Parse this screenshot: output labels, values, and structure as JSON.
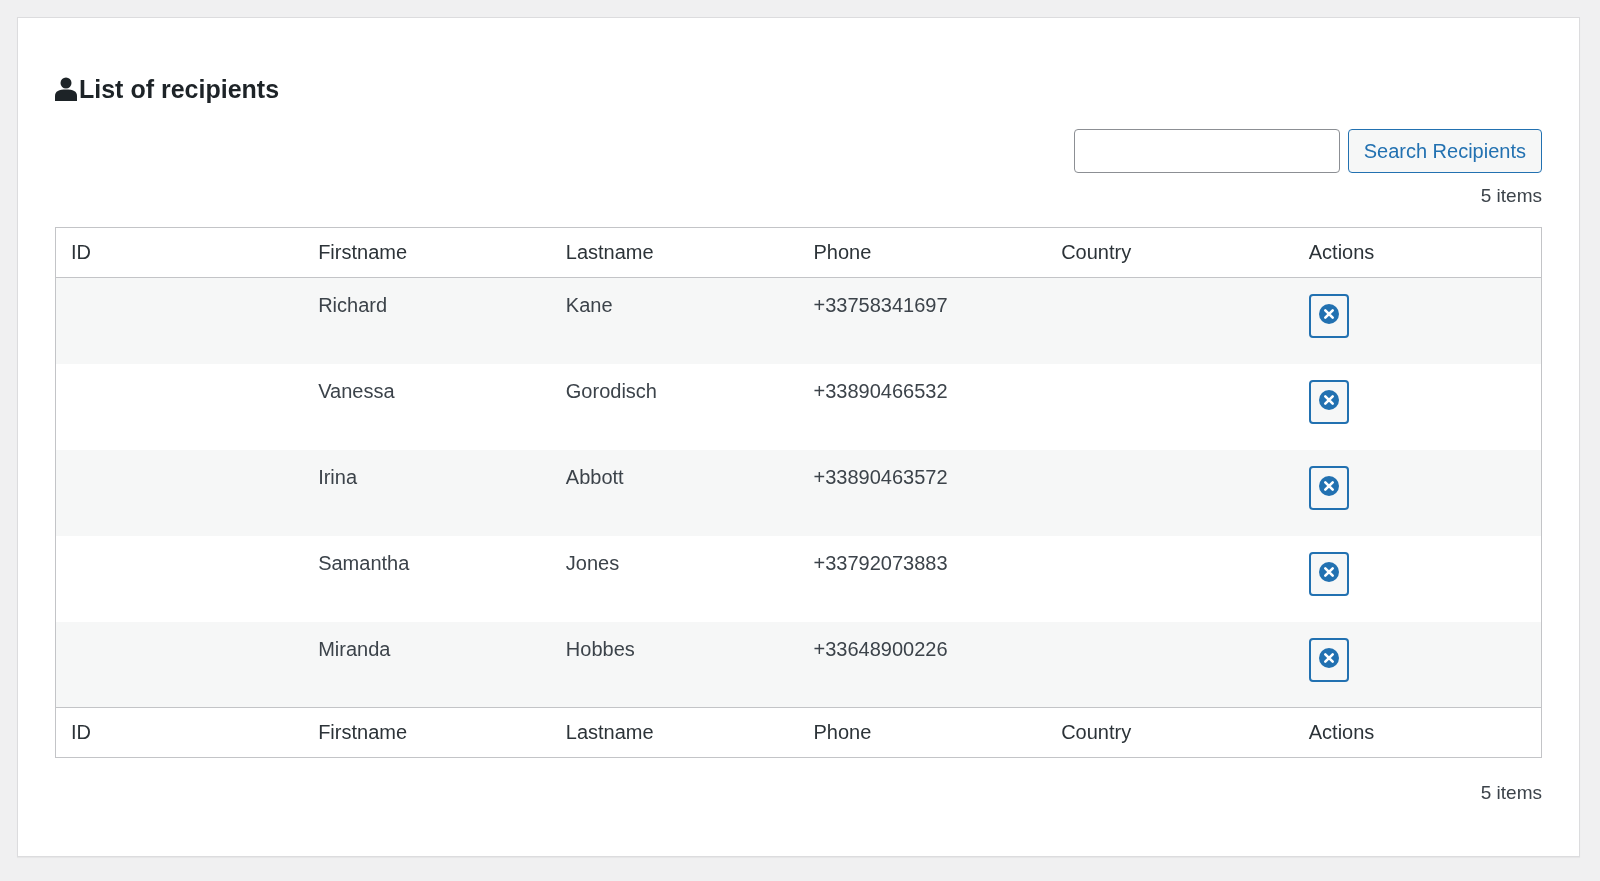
{
  "title": "List of recipients",
  "search": {
    "button": "Search Recipients"
  },
  "count_top": "5 items",
  "table": {
    "columns": [
      "ID",
      "Firstname",
      "Lastname",
      "Phone",
      "Country",
      "Actions"
    ],
    "rows": [
      {
        "firstname": "Richard",
        "lastname": "Kane",
        "phone": "+33758341697"
      },
      {
        "firstname": "Vanessa",
        "lastname": "Gorodisch",
        "phone": "+33890466532"
      },
      {
        "firstname": "Irina",
        "lastname": "Abbott",
        "phone": "+33890463572"
      },
      {
        "firstname": "Samantha",
        "lastname": "Jones",
        "phone": "+33792073883"
      },
      {
        "firstname": "Miranda",
        "lastname": "Hobbes",
        "phone": "+33648900226"
      }
    ],
    "footer_columns": [
      "ID",
      "Firstname",
      "Lastname",
      "Phone",
      "Country",
      "Actions"
    ]
  },
  "count_bottom": "5 items"
}
